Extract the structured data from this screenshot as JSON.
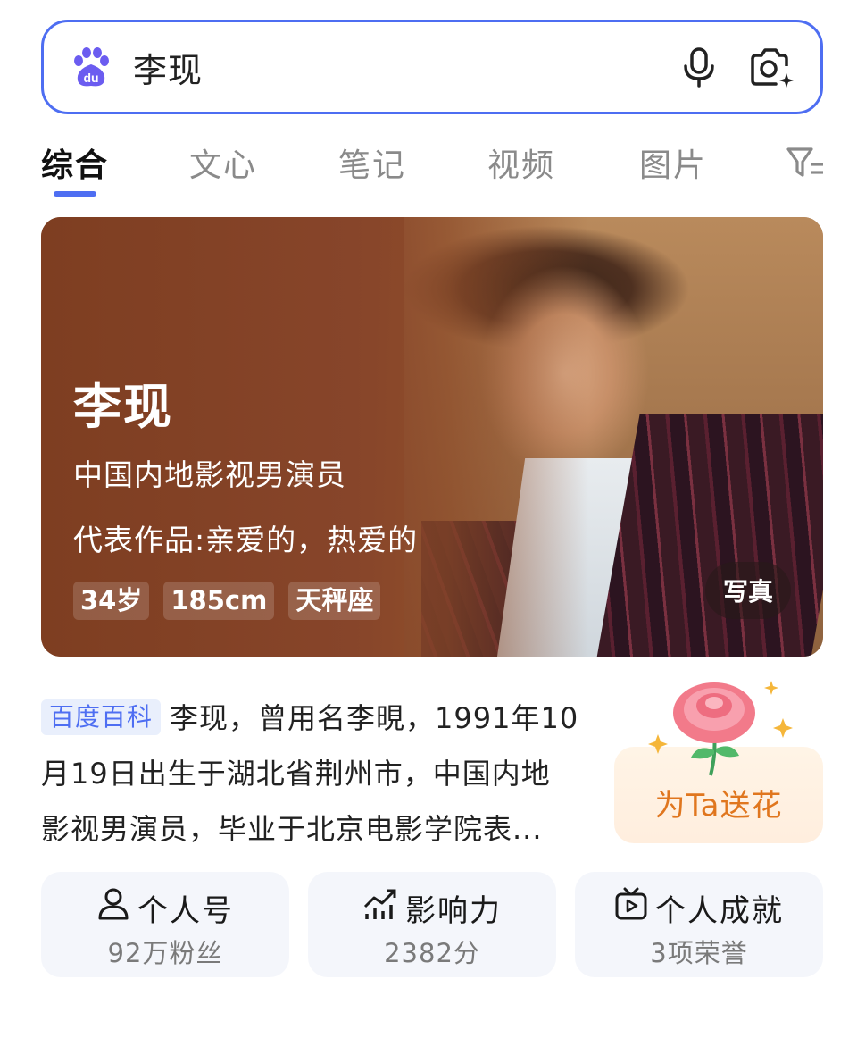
{
  "search": {
    "query": "李现",
    "logo_text": "du",
    "icons": [
      "baidu-paw-logo",
      "microphone-icon",
      "camera-search-icon"
    ]
  },
  "tabs": [
    {
      "label": "综合",
      "active": true
    },
    {
      "label": "文心",
      "active": false
    },
    {
      "label": "笔记",
      "active": false
    },
    {
      "label": "视频",
      "active": false
    },
    {
      "label": "图片",
      "active": false
    }
  ],
  "hero": {
    "name": "李现",
    "line1": "中国内地影视男演员",
    "line2": "代表作品:亲爱的，热爱的",
    "tags": [
      "34岁",
      "185cm",
      "天秤座"
    ],
    "photo_button": "写真"
  },
  "intro": {
    "badge": "百度百科",
    "row1": "李现，曾用名李晛，1991年10",
    "row2": "月19日出生于湖北省荆州市，中国内地",
    "row3": "影视男演员，毕业于北京电影学院表..."
  },
  "flower": {
    "label": "为Ta送花"
  },
  "stats": [
    {
      "title": "个人号",
      "value": "92万粉丝",
      "icon": "person-icon"
    },
    {
      "title": "影响力",
      "value": "2382分",
      "icon": "trend-chart-icon"
    },
    {
      "title": "个人成就",
      "value": "3项荣誉",
      "icon": "tv-play-icon"
    }
  ],
  "colors": {
    "accent": "#4e6ef2",
    "hero_brown": "#8c4a27",
    "flower_text": "#e0761e"
  }
}
